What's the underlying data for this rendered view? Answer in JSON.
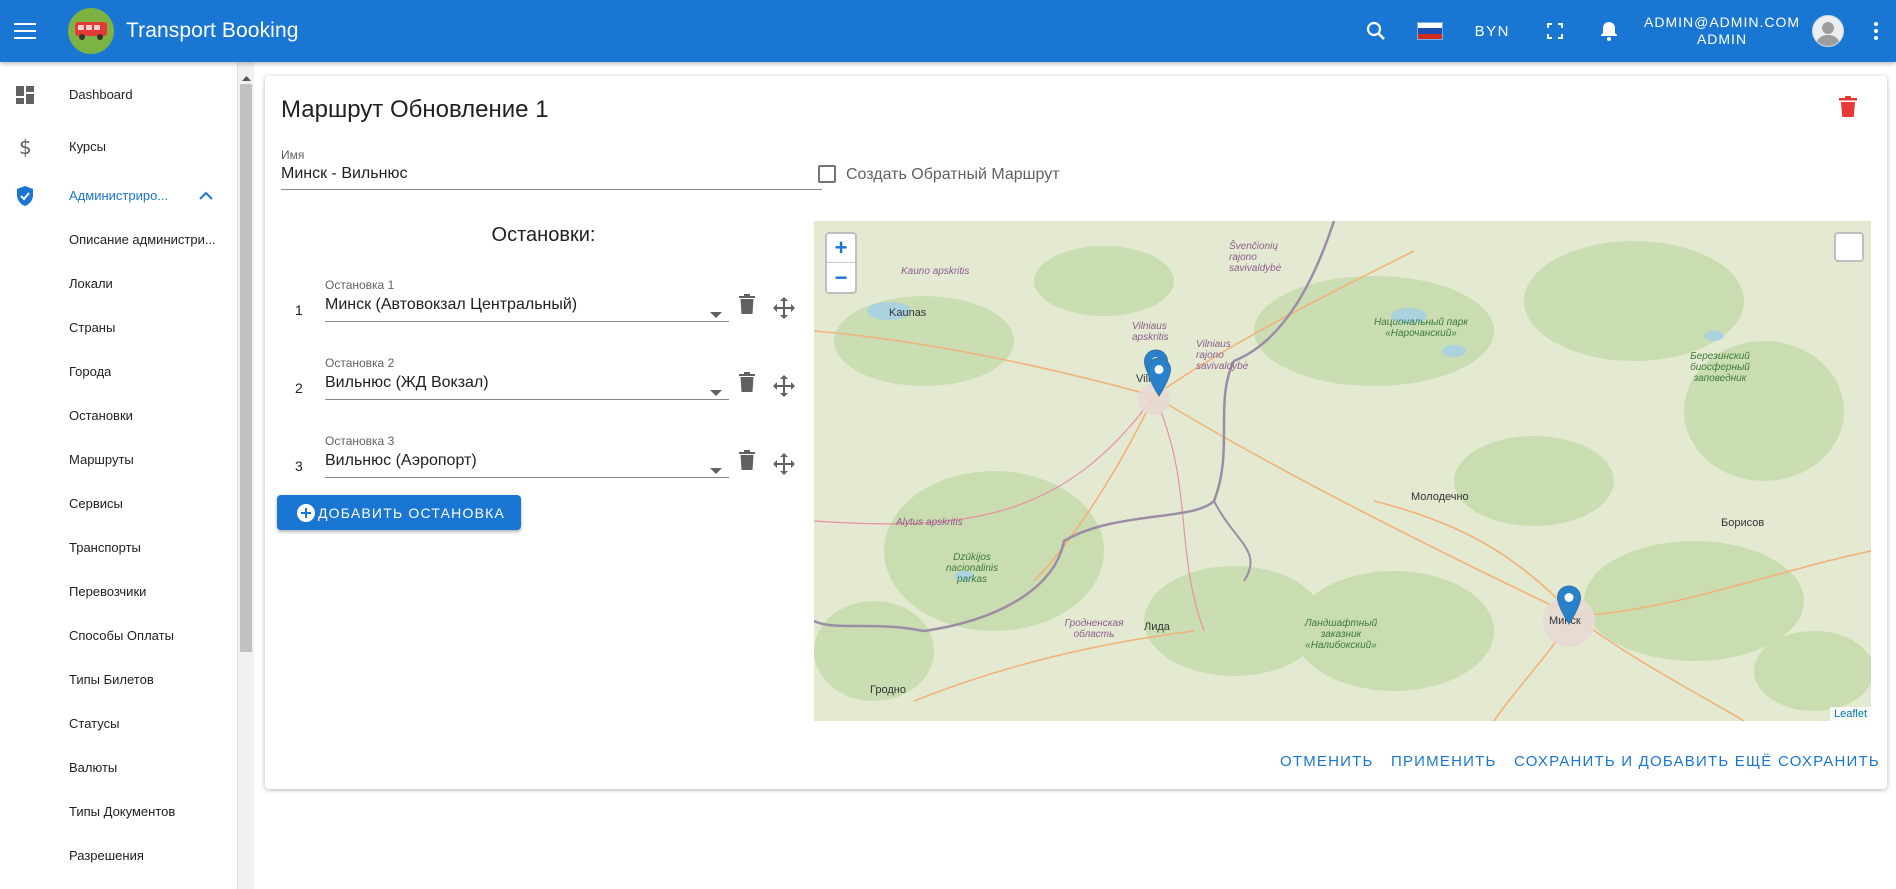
{
  "app": {
    "title": "Transport Booking",
    "currency": "BYN",
    "user_email": "ADMIN@ADMIN.COM",
    "user_name": "ADMIN",
    "colors": {
      "primary": "#1976d2",
      "danger": "#e53935"
    }
  },
  "sidebar": {
    "items": [
      {
        "label": "Dashboard",
        "icon": "dashboard-icon"
      },
      {
        "label": "Курсы",
        "icon": "dollar-icon"
      },
      {
        "label": "Администриро...",
        "icon": "shield-check-icon",
        "active": true
      },
      {
        "label": "Описание администри..."
      },
      {
        "label": "Локали"
      },
      {
        "label": "Страны"
      },
      {
        "label": "Города"
      },
      {
        "label": "Остановки"
      },
      {
        "label": "Маршруты"
      },
      {
        "label": "Сервисы"
      },
      {
        "label": "Транспорты"
      },
      {
        "label": "Перевозчики"
      },
      {
        "label": "Способы Оплаты"
      },
      {
        "label": "Типы Билетов"
      },
      {
        "label": "Статусы"
      },
      {
        "label": "Валюты"
      },
      {
        "label": "Типы Документов"
      },
      {
        "label": "Разрешения"
      }
    ]
  },
  "form": {
    "title": "Маршрут Обновление 1",
    "name_label": "Имя",
    "name_value": "Минск - Вильнюс",
    "reverse_label": "Создать Обратный Маршрут",
    "stops_title": "Остановки:",
    "stops": [
      {
        "num": "1",
        "label": "Остановка 1",
        "value": "Минск (Автовокзал Центральный)"
      },
      {
        "num": "2",
        "label": "Остановка 2",
        "value": "Вильнюс (ЖД Вокзал)"
      },
      {
        "num": "3",
        "label": "Остановка 3",
        "value": "Вильнюс (Аэропорт)"
      }
    ],
    "add_stop_label": "ДОБАВИТЬ ОСТАНОВКА"
  },
  "map": {
    "zoom_in": "+",
    "zoom_out": "−",
    "attribution": "Leaflet",
    "labels": {
      "kaunas_region": "Kauno apskritis",
      "kaunas": "Kaunas",
      "vilnius_region": "Vilniaus apskritis",
      "vilnius": "Vilnius",
      "vilnius_district": "Vilniaus rajono savivaldybė",
      "svencionys": "Švenčionių rajono savivaldybė",
      "naroch": "Национальный парк «Нарочанский»",
      "berezinsky": "Березинский биосферный заповедник",
      "molodechno": "Молодечно",
      "borisov": "Борисов",
      "alytus": "Alytus apskritis",
      "dzukija": "Dzūkijos nacionalinis parkas",
      "grodno_region": "Гродненская область",
      "lida": "Лида",
      "naliboki": "Ландшафтный заказник «Налибокский»",
      "minsk": "Минск",
      "grodno": "Гродно",
      "parkas": "parkas"
    }
  },
  "actions": {
    "cancel": "ОТМЕНИТЬ",
    "apply": "ПРИМЕНИТЬ",
    "save_add": "СОХРАНИТЬ И ДОБАВИТЬ ЕЩЁ",
    "save": "СОХРАНИТЬ"
  }
}
